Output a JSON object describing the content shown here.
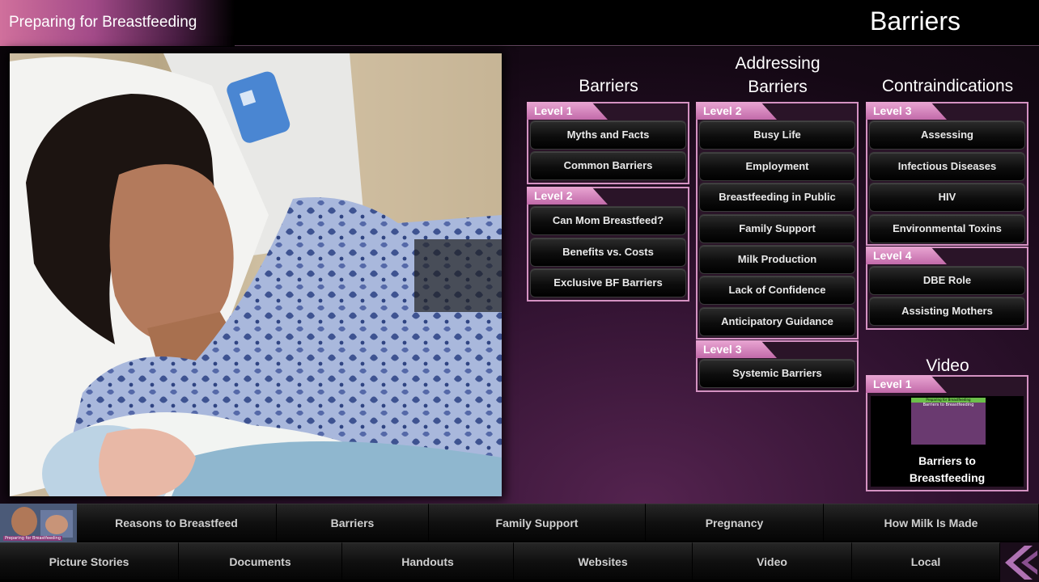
{
  "header": {
    "app_title": "Preparing for Breastfeeding",
    "page_title": "Barriers"
  },
  "columns": {
    "barriers": {
      "title": "Barriers",
      "groups": [
        {
          "level": "Level 1",
          "items": [
            "Myths and Facts",
            "Common Barriers"
          ]
        },
        {
          "level": "Level 2",
          "items": [
            "Can Mom Breastfeed?",
            "Benefits vs. Costs",
            "Exclusive BF Barriers"
          ]
        }
      ]
    },
    "addressing": {
      "title_line1": "Addressing",
      "title_line2": "Barriers",
      "groups": [
        {
          "level": "Level 2",
          "items": [
            "Busy Life",
            "Employment",
            "Breastfeeding in Public",
            "Family Support",
            "Milk Production",
            "Lack of Confidence",
            "Anticipatory Guidance"
          ]
        },
        {
          "level": "Level 3",
          "items": [
            "Systemic Barriers"
          ]
        }
      ]
    },
    "contraindications": {
      "title": "Contraindications",
      "groups": [
        {
          "level": "Level 3",
          "items": [
            "Assessing",
            "Infectious Diseases",
            "HIV",
            "Environmental Toxins"
          ]
        },
        {
          "level": "Level 4",
          "items": [
            "DBE Role",
            "Assisting Mothers"
          ]
        }
      ]
    },
    "video": {
      "title": "Video",
      "level": "Level 1",
      "thumb_header": "Preparing for Breastfeeding",
      "thumb_caption": "Barriers to Breastfeeding",
      "video_title_line1": "Barriers to",
      "video_title_line2": "Breastfeeding"
    }
  },
  "nav": {
    "thumb_label": "Preparing for Breastfeeding",
    "row1": [
      "Reasons to Breastfeed",
      "Barriers",
      "Family Support",
      "Pregnancy",
      "How Milk Is Made"
    ],
    "row2": [
      "Picture Stories",
      "Documents",
      "Handouts",
      "Websites",
      "Video",
      "Local"
    ]
  }
}
